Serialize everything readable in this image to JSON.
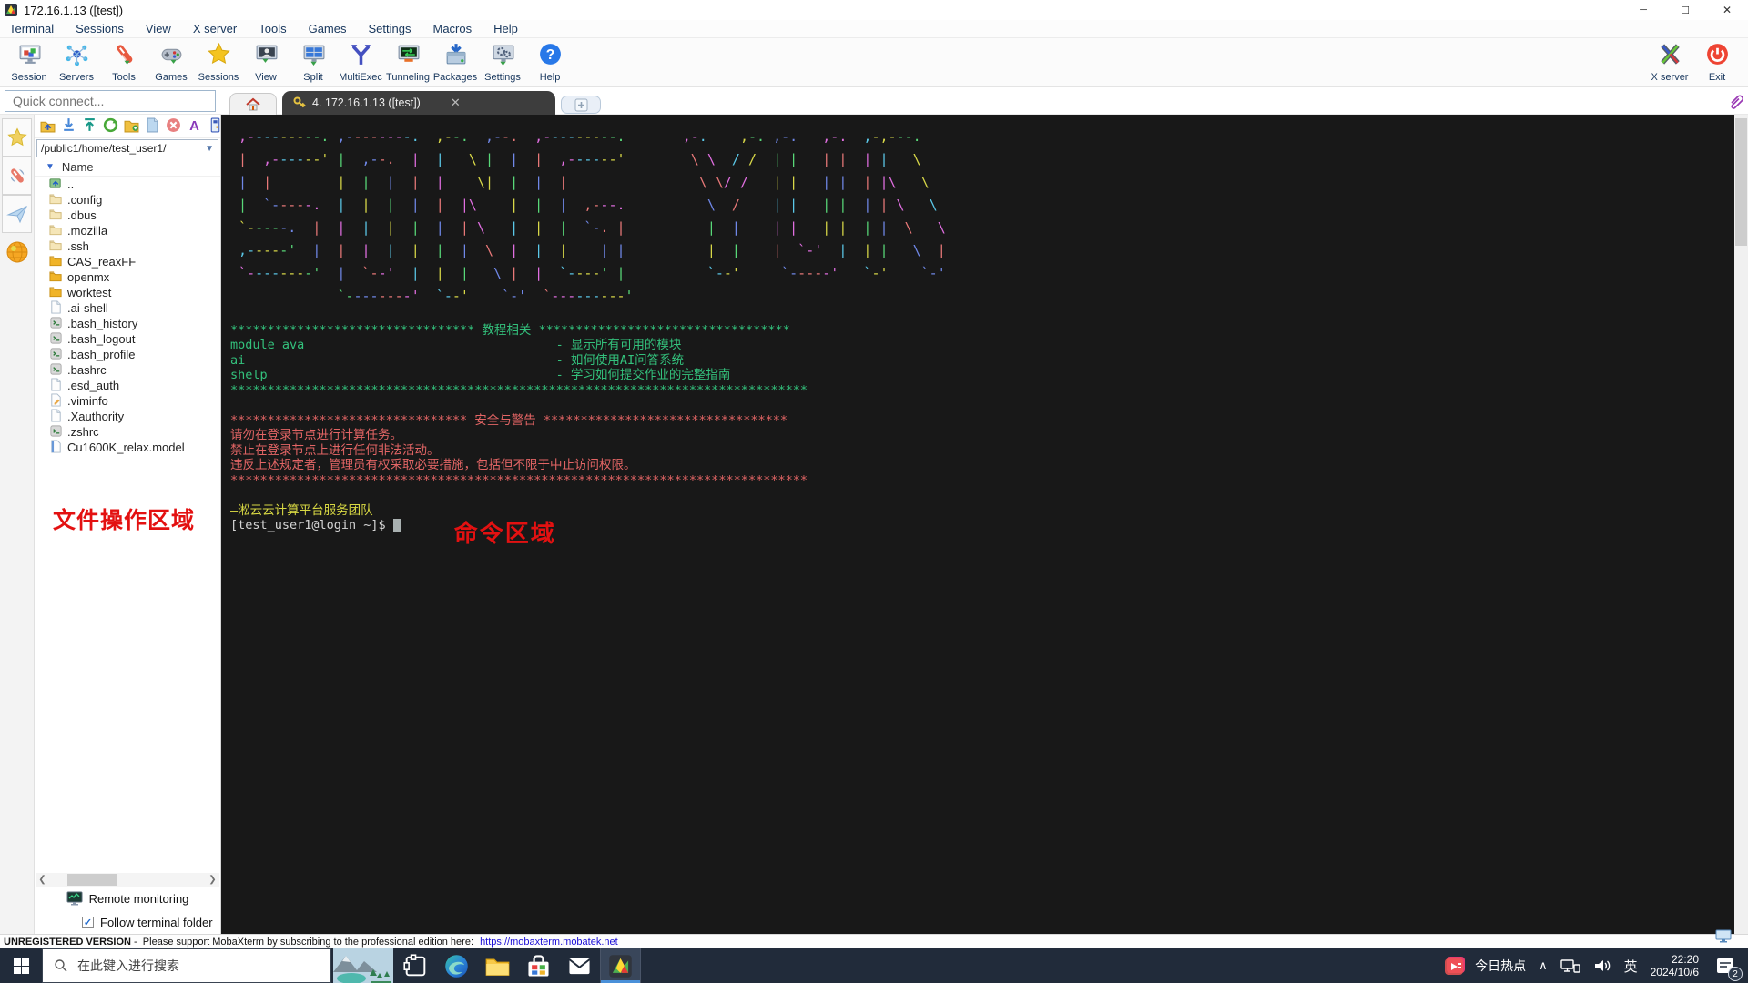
{
  "window": {
    "title": "172.16.1.13 ([test])",
    "minimize": "─",
    "maximize": "☐",
    "close": "✕"
  },
  "menu": {
    "items": [
      "Terminal",
      "Sessions",
      "View",
      "X server",
      "Tools",
      "Games",
      "Settings",
      "Macros",
      "Help"
    ]
  },
  "toolbar": {
    "items": [
      {
        "id": "session",
        "label": "Session"
      },
      {
        "id": "servers",
        "label": "Servers"
      },
      {
        "id": "tools",
        "label": "Tools"
      },
      {
        "id": "games",
        "label": "Games"
      },
      {
        "id": "sessions",
        "label": "Sessions"
      },
      {
        "id": "view",
        "label": "View"
      },
      {
        "id": "split",
        "label": "Split"
      },
      {
        "id": "multiexec",
        "label": "MultiExec"
      },
      {
        "id": "tunneling",
        "label": "Tunneling"
      },
      {
        "id": "packages",
        "label": "Packages"
      },
      {
        "id": "settings",
        "label": "Settings"
      },
      {
        "id": "help",
        "label": "Help"
      }
    ],
    "right": [
      {
        "id": "xserver",
        "label": "X server"
      },
      {
        "id": "exit",
        "label": "Exit"
      }
    ]
  },
  "quick_connect": {
    "placeholder": "Quick connect..."
  },
  "tabs": {
    "active_label": "4. 172.16.1.13 ([test])",
    "close": "✕",
    "new": "✛"
  },
  "sidebar": {
    "strip_icons": [
      "sessions-star-icon",
      "tools-knife-icon",
      "macros-plane-icon",
      "sftp-globe-icon"
    ],
    "toolbar_icons": [
      "go-up-icon",
      "download-icon",
      "upload-icon",
      "refresh-icon",
      "new-folder-icon",
      "new-file-icon",
      "delete-icon",
      "font-icon",
      "encoding-icon"
    ],
    "path": "/public1/home/test_user1/",
    "name_header": "Name",
    "files": [
      {
        "name": "..",
        "type": "up"
      },
      {
        "name": ".config",
        "type": "folder"
      },
      {
        "name": ".dbus",
        "type": "folder"
      },
      {
        "name": ".mozilla",
        "type": "folder"
      },
      {
        "name": ".ssh",
        "type": "folder"
      },
      {
        "name": "CAS_reaxFF",
        "type": "dfolder"
      },
      {
        "name": "openmx",
        "type": "dfolder"
      },
      {
        "name": "worktest",
        "type": "dfolder"
      },
      {
        "name": ".ai-shell",
        "type": "page"
      },
      {
        "name": ".bash_history",
        "type": "script"
      },
      {
        "name": ".bash_logout",
        "type": "script"
      },
      {
        "name": ".bash_profile",
        "type": "script"
      },
      {
        "name": ".bashrc",
        "type": "script"
      },
      {
        "name": ".esd_auth",
        "type": "page"
      },
      {
        "name": ".viminfo",
        "type": "pencil"
      },
      {
        "name": ".Xauthority",
        "type": "page"
      },
      {
        "name": ".zshrc",
        "type": "script"
      },
      {
        "name": "Cu1600K_relax.model",
        "type": "model"
      }
    ],
    "annotation": "文件操作区域",
    "remote_monitoring": "Remote monitoring",
    "follow_checkbox": "Follow terminal folder",
    "check_glyph": "✓"
  },
  "terminal": {
    "palette": [
      "#e06ee0",
      "#5bc8e8",
      "#d8d848",
      "#58d878",
      "#7088e8",
      "#e87878"
    ],
    "ascii_art": [
      " ,---------. ,--------.  ,--.  ,--.  ,---------.       ,-.    ,-. ,-.   ,-.  ,-,---.   ",
      " |  ,------' |  ,--.  |  |   \\ |  |  |  ,------'        \\ \\  / /  | |   | |  | |   \\   ",
      " |  |        |  |  |  |  |    \\|  |  |  |                \\ \\/ /   | |   | |  | |\\   \\  ",
      " |  `-----.  |  |  |  |  |  |\\    |  |  |  ,---.          \\  /    | |   | |  | | \\   \\ ",
      " `-----.  |  |  |  |  |  |  | \\   |  |  |  `-. |          |  |    | |   | |  | |  \\   \\",
      " ,-----'  |  |  |  |  |  |  |  \\  |  |  |    | |          |  |    |  `-'  |  | |   \\  |",
      " `--------'  |  `--'  |  |  |   \\ |  |  `----' |          `--'     `-----'   `-'    `-'",
      "             `--------'  `--'    `-'  `---------'                                      "
    ],
    "tutorial": {
      "color": "#33c17c",
      "lines": [
        "********************************* 教程相关 **********************************",
        "module ava                                  - 显示所有可用的模块",
        "ai                                          - 如何使用AI问答系统",
        "shelp                                       - 学习如何提交作业的完整指南",
        "******************************************************************************"
      ]
    },
    "security": {
      "color": "#e36565",
      "lines": [
        "******************************** 安全与警告 *********************************",
        "请勿在登录节点进行计算任务。",
        "禁止在登录节点上进行任何非法活动。",
        "违反上述规定者，管理员有权采取必要措施，包括但不限于中止访问权限。",
        "******************************************************************************"
      ]
    },
    "team_line": {
      "color": "#d9d943",
      "text": "—淞云云计算平台服务团队"
    },
    "prompt": "[test_user1@login ~]$",
    "annotation": "命令区域"
  },
  "statusbar": {
    "bold": "UNREGISTERED VERSION",
    "text": " -  Please support MobaXterm by subscribing to the professional edition here: ",
    "link": "https://mobaxterm.mobatek.net"
  },
  "taskbar": {
    "search_placeholder": "在此键入进行搜索",
    "apps": [
      "task-view",
      "edge",
      "file-explorer",
      "store",
      "mail",
      "mobaxterm"
    ],
    "hotspot": "今日热点",
    "chevron": "∧",
    "ime": "英",
    "time": "22:20",
    "date": "2024/10/6",
    "badge": "2"
  }
}
